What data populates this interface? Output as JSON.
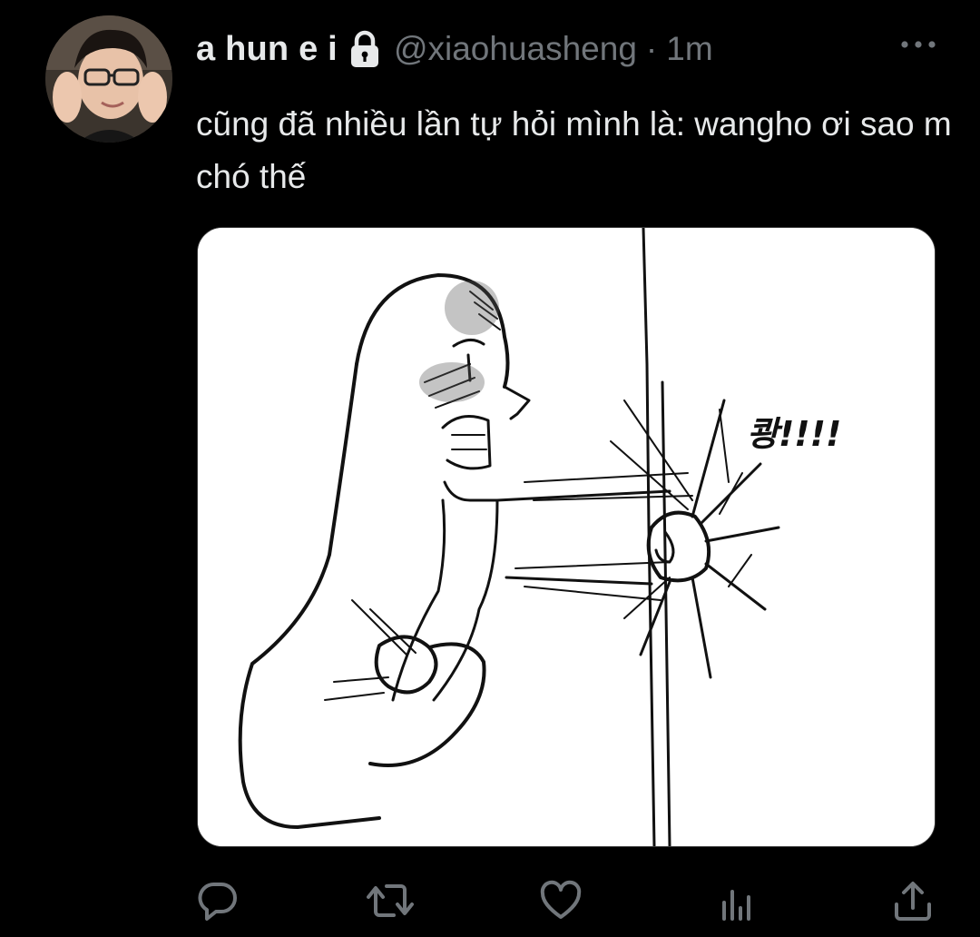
{
  "tweet": {
    "display_name": "a hun e i",
    "handle": "@xiaohuasheng",
    "separator": "·",
    "time": "1m",
    "text": "cũng đã nhiều lần tự hỏi mình là: wangho ơi sao m chó thế",
    "protected_icon": "lock-icon",
    "more_icon": "more-dots-icon"
  },
  "media": {
    "sound_effect_text": "쾅!!!!"
  },
  "actions": [
    {
      "name": "reply",
      "icon": "reply-icon"
    },
    {
      "name": "retweet",
      "icon": "retweet-icon"
    },
    {
      "name": "like",
      "icon": "heart-icon"
    },
    {
      "name": "analytics",
      "icon": "analytics-icon"
    },
    {
      "name": "share",
      "icon": "share-icon"
    }
  ],
  "colors": {
    "background": "#000000",
    "text_primary": "#e7e9ea",
    "text_secondary": "#71767b"
  }
}
